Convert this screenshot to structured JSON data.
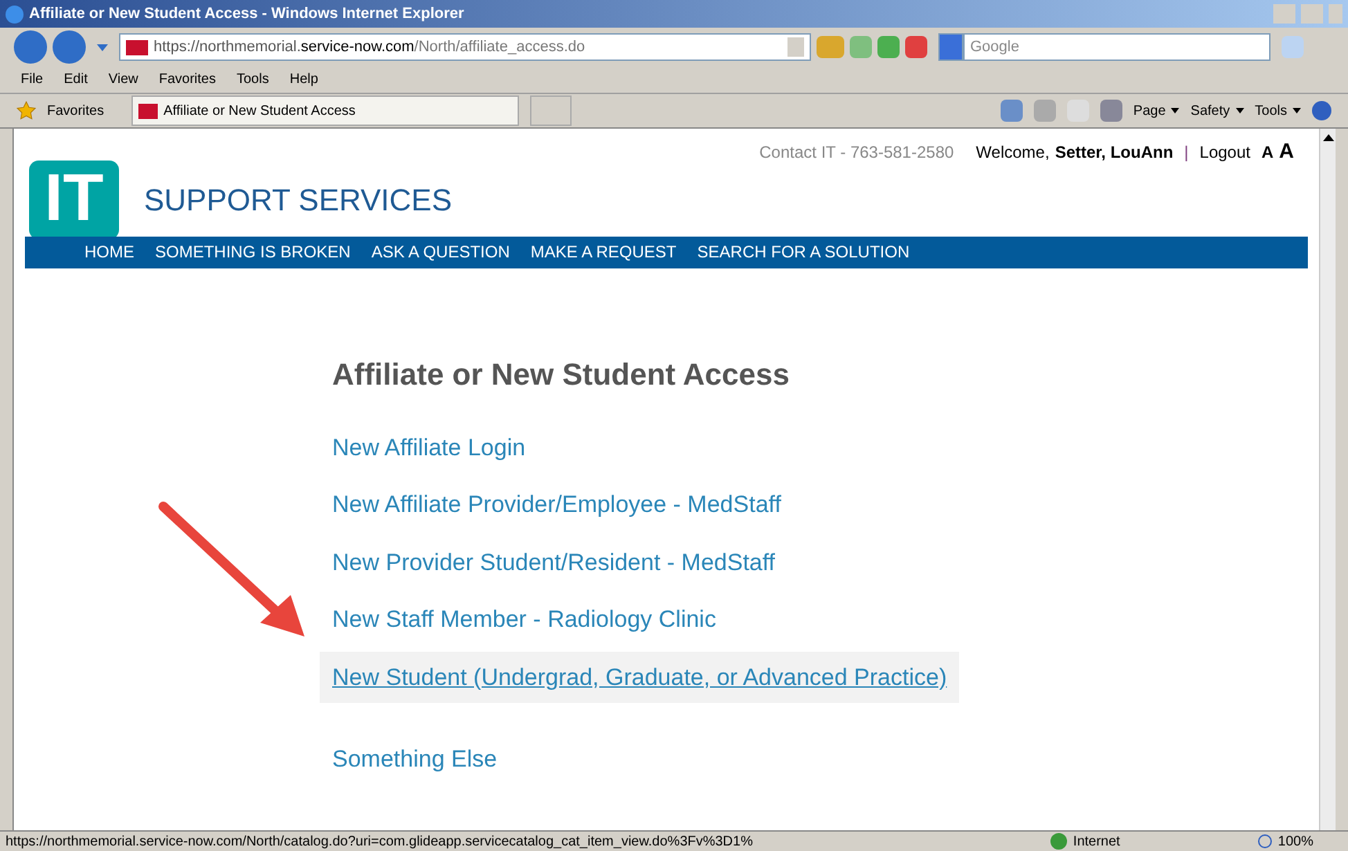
{
  "window": {
    "title": "Affiliate or New Student Access - Windows Internet Explorer"
  },
  "address_bar": {
    "url_host": "https://northmemorial.",
    "url_domain": "service-now.com",
    "url_path": "/North/affiliate_access.do"
  },
  "search": {
    "placeholder": "Google"
  },
  "menu": [
    "File",
    "Edit",
    "View",
    "Favorites",
    "Tools",
    "Help"
  ],
  "favorites": {
    "label": "Favorites",
    "tab": "Affiliate or New Student Access"
  },
  "command_bar": [
    "Page",
    "Safety",
    "Tools"
  ],
  "header": {
    "contact": "Contact IT - 763-581-2580",
    "welcome": "Welcome,",
    "user": "Setter, LouAnn",
    "separator": "|",
    "logout": "Logout",
    "font_small": "A",
    "font_large": "A",
    "logo": "IT",
    "title": "SUPPORT SERVICES"
  },
  "nav": [
    "HOME",
    "SOMETHING IS BROKEN",
    "ASK A QUESTION",
    "MAKE A REQUEST",
    "SEARCH FOR A SOLUTION"
  ],
  "page": {
    "heading": "Affiliate or New Student Access",
    "links": [
      {
        "label": "New Affiliate Login",
        "highlighted": false
      },
      {
        "label": "New Affiliate Provider/Employee - MedStaff",
        "highlighted": false
      },
      {
        "label": "New Provider Student/Resident - MedStaff",
        "highlighted": false
      },
      {
        "label": "New Staff Member - Radiology Clinic",
        "highlighted": false
      },
      {
        "label": "New Student (Undergrad, Graduate, or Advanced Practice)",
        "highlighted": true
      }
    ],
    "other_link": {
      "label": "Something Else",
      "highlighted": false
    }
  },
  "status_bar": {
    "url": "https://northmemorial.service-now.com/North/catalog.do?uri=com.glideapp.servicecatalog_cat_item_view.do%3Fv%3D1%",
    "zone": "Internet",
    "zoom": "100%"
  }
}
